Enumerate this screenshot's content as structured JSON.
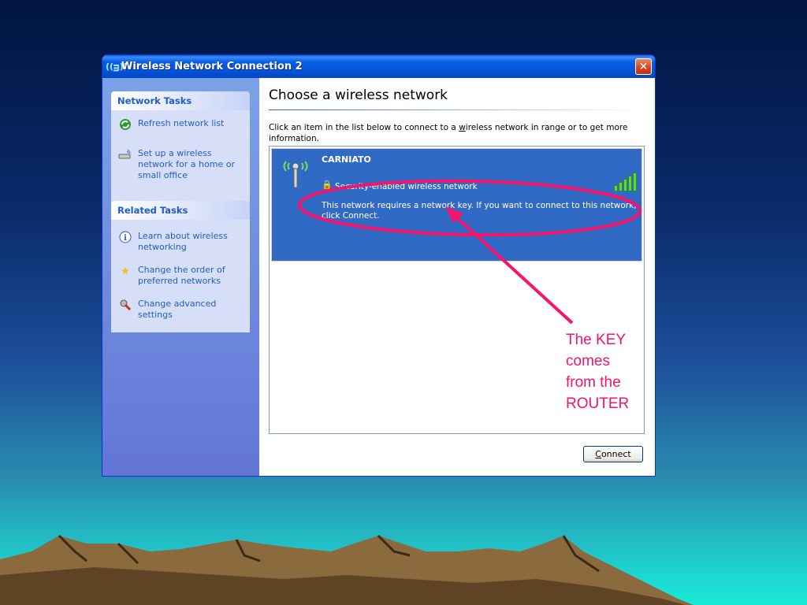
{
  "window": {
    "title": "Wireless Network Connection 2",
    "title_icon": "((ᴟ))",
    "close_glyph": "✕"
  },
  "network_tasks": {
    "header": "Network Tasks",
    "items": [
      {
        "label": "Refresh network list",
        "icon": "refresh-icon"
      },
      {
        "label": "Set up a wireless network for a home or small office",
        "icon": "setup-wireless-icon"
      }
    ]
  },
  "related_tasks": {
    "header": "Related Tasks",
    "items": [
      {
        "label": "Learn about wireless networking",
        "icon": "info-icon"
      },
      {
        "label": "Change the order of preferred networks",
        "icon": "star-icon"
      },
      {
        "label": "Change advanced settings",
        "icon": "settings-icon"
      }
    ]
  },
  "main": {
    "heading": "Choose a wireless network",
    "description_pre": "Click an item in the list below to connect to a ",
    "description_underlined": "w",
    "description_post": "ireless network in range or to get more information."
  },
  "network": {
    "ssid": "CARNIATO",
    "security": "Security-enabled wireless network",
    "message": "This network requires a network key. If you want to connect to this network, click Connect."
  },
  "connect_button": {
    "label_underlined": "C",
    "label_rest": "onnect"
  },
  "annotation": {
    "lines": [
      "The KEY",
      "comes",
      "from the",
      "ROUTER"
    ],
    "color": "#f7126a"
  }
}
